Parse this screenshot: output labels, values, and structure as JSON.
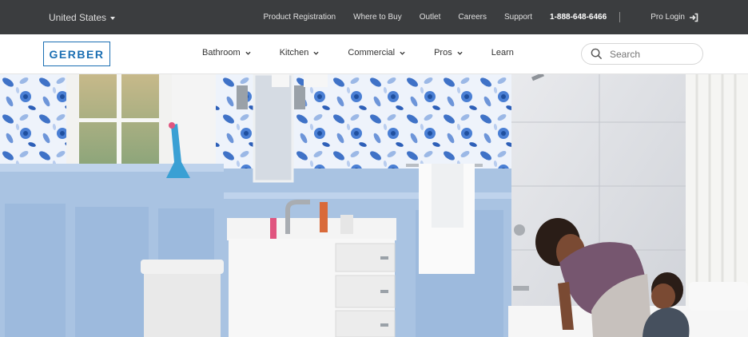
{
  "topbar": {
    "region": "United States",
    "links": [
      "Product Registration",
      "Where to Buy",
      "Outlet",
      "Careers",
      "Support"
    ],
    "phone": "1-888-648-6466",
    "pro_login": "Pro Login"
  },
  "navbar": {
    "logo": "GERBER",
    "items": [
      {
        "label": "Bathroom"
      },
      {
        "label": "Kitchen"
      },
      {
        "label": "Commercial"
      },
      {
        "label": "Pros"
      },
      {
        "label": "Learn"
      }
    ],
    "search_placeholder": "Search"
  },
  "colors": {
    "topbar": "#3b3d3f",
    "brand_blue": "#1b6fb3",
    "wainscot": "#a9c3e2"
  }
}
